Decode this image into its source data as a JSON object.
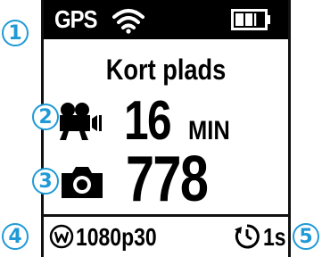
{
  "status_bar": {
    "gps_label": "GPS",
    "wifi_icon": "wifi-icon",
    "battery_icon": "battery-icon",
    "battery_level": 0.75
  },
  "mode": {
    "label": "Kort plads"
  },
  "video": {
    "icon": "video-camera-icon",
    "value": "16",
    "unit": "MIN"
  },
  "photo": {
    "icon": "camera-icon",
    "value": "778"
  },
  "bottom_bar": {
    "resolution_icon": "resolution-w-icon",
    "resolution": "1080p30",
    "timer_icon": "self-timer-icon",
    "timer": "1s"
  },
  "callouts": [
    "1",
    "2",
    "3",
    "4",
    "5"
  ],
  "colors": {
    "callout": "#1f9ad6",
    "screen_bg": "#ffffff",
    "statusbar_bg": "#000000"
  }
}
